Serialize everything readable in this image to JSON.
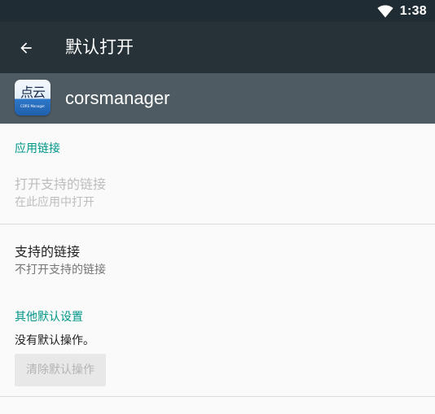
{
  "status_bar": {
    "time": "1:38",
    "wifi_icon": "wifi-full-icon"
  },
  "app_bar": {
    "back_icon": "arrow-back-icon",
    "title": "默认打开"
  },
  "app_header": {
    "icon_name": "corsmanager-app-icon",
    "icon_text": "点云",
    "icon_subtext": "CORS Manager",
    "app_name": "corsmanager"
  },
  "app_links_section": {
    "header": "应用链接",
    "open_supported_links": {
      "title": "打开支持的链接",
      "summary": "在此应用中打开",
      "enabled": false
    },
    "supported_links": {
      "title": "支持的链接",
      "summary": "不打开支持的链接"
    }
  },
  "other_defaults_section": {
    "header": "其他默认设置",
    "summary": "没有默认操作。",
    "clear_button_label": "清除默认操作",
    "clear_button_enabled": false
  },
  "colors": {
    "status_bar": "#1f2c33",
    "app_bar": "#263238",
    "app_header": "#4f5b62",
    "accent": "#009688",
    "background": "#fafafa"
  }
}
